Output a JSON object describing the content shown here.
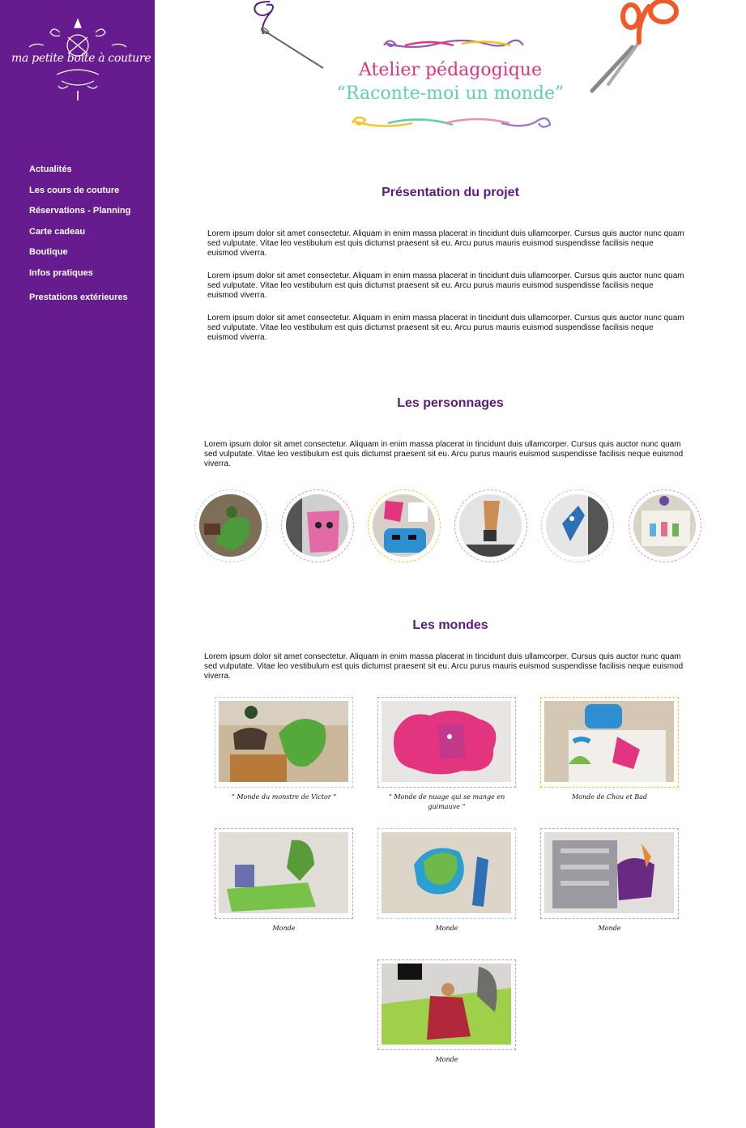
{
  "sidebar": {
    "logo_text": "ma petite boîte à couture",
    "nav": [
      "Actualités",
      "Les cours de couture",
      "Réservations - Planning",
      "Carte cadeau",
      "Boutique",
      "Infos pratiques",
      "Prestations extérieures"
    ]
  },
  "hero": {
    "title_line1": "Atelier pédagogique",
    "title_line2": "“Raconte-moi un monde”"
  },
  "sections": {
    "presentation": {
      "title": "Présentation du projet",
      "paragraphs": [
        "Lorem ipsum dolor sit amet consectetur. Aliquam in enim massa placerat in tincidunt duis ullamcorper. Cursus quis auctor nunc quam sed vulputate. Vitae leo vestibulum est quis dictumst praesent sit eu. Arcu purus mauris euismod suspendisse facilisis neque euismod viverra.",
        "Lorem ipsum dolor sit amet consectetur. Aliquam in enim massa placerat in tincidunt duis ullamcorper. Cursus quis auctor nunc quam sed vulputate. Vitae leo vestibulum est quis dictumst praesent sit eu. Arcu purus mauris euismod suspendisse facilisis neque euismod viverra.",
        "Lorem ipsum dolor sit amet consectetur. Aliquam in enim massa placerat in tincidunt duis ullamcorper. Cursus quis auctor nunc quam sed vulputate. Vitae leo vestibulum est quis dictumst praesent sit eu. Arcu purus mauris euismod suspendisse facilisis neque euismod viverra."
      ]
    },
    "personnages": {
      "title": "Les personnages",
      "paragraph": "Lorem ipsum dolor sit amet consectetur. Aliquam in enim massa placerat in tincidunt duis ullamcorper. Cursus quis auctor nunc quam sed vulputate. Vitae leo vestibulum est quis dictumst praesent sit eu. Arcu purus mauris euismod suspendisse facilisis neque euismod viverra."
    },
    "mondes": {
      "title": "Les mondes",
      "paragraph": "Lorem ipsum dolor sit amet consectetur. Aliquam in enim massa placerat in tincidunt duis ullamcorper. Cursus quis auctor nunc quam sed vulputate. Vitae leo vestibulum est quis dictumst praesent sit eu. Arcu purus mauris euismod suspendisse facilisis neque euismod viverra.",
      "captions": [
        "“ Monde du monstre de Victor ”",
        "“ Monde de nuage qui se mange en guimauve ”",
        "Monde de Chou et Bad",
        "Monde",
        "Monde",
        "Monde",
        "Monde"
      ]
    }
  },
  "colors": {
    "sidebar": "#661C8E",
    "section_title": "#5B1B80",
    "hero_line1": "#E2347F",
    "hero_line2": "#5CD0B0"
  },
  "icons": [
    "logo-emblem-icon",
    "needle-thread-icon",
    "scissors-icon",
    "swirl-ornament-icon"
  ]
}
